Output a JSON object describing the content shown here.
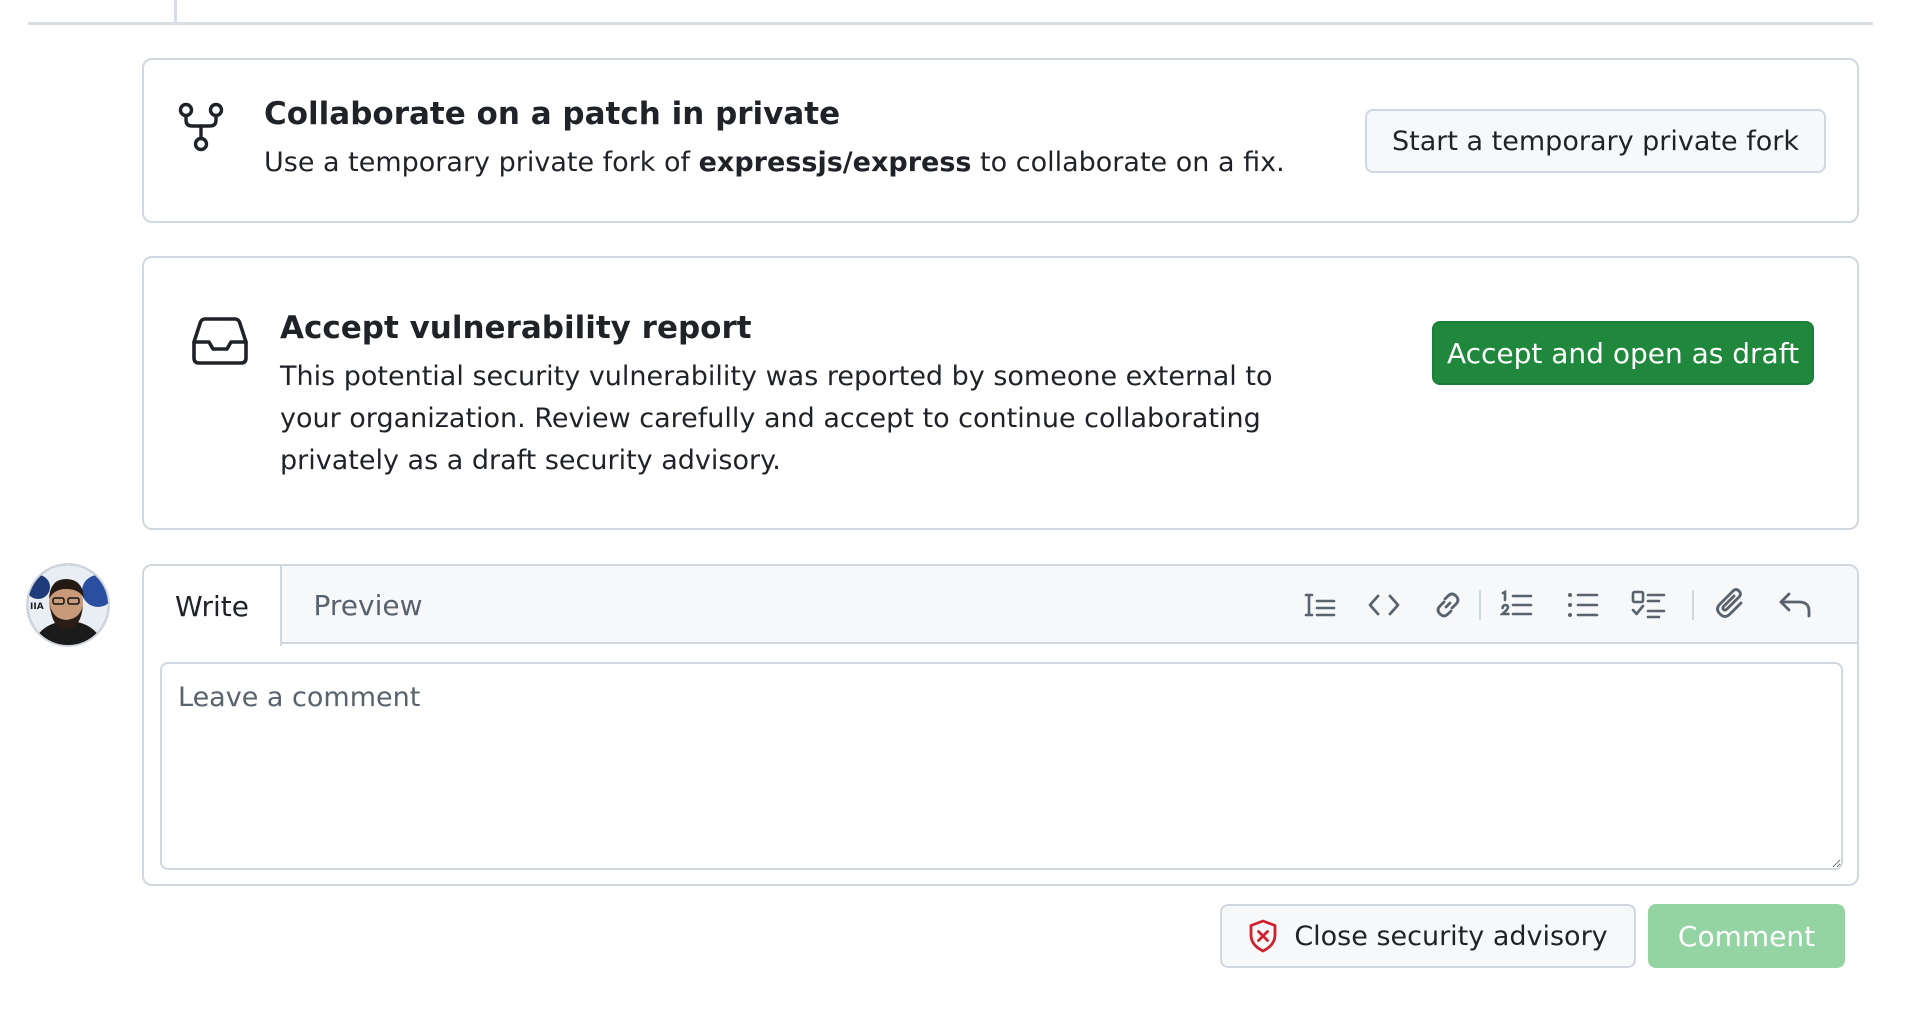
{
  "fork_card": {
    "title": "Collaborate on a patch in private",
    "desc_prefix": "Use a temporary private fork of ",
    "repo": "expressjs/express",
    "desc_suffix": " to collaborate on a fix.",
    "button_label": "Start a temporary private fork",
    "icon": "repo-forked-icon"
  },
  "accept_card": {
    "title": "Accept vulnerability report",
    "description": "This potential security vulnerability was reported by someone external to your organization. Review carefully and accept to continue collaborating privately as a draft security advisory.",
    "button_label": "Accept and open as draft",
    "icon": "inbox-icon"
  },
  "editor": {
    "tabs": [
      {
        "label": "Write",
        "active": true
      },
      {
        "label": "Preview",
        "active": false
      }
    ],
    "toolbar": [
      "heading-icon",
      "code-icon",
      "link-icon",
      "ordered-list-icon",
      "unordered-list-icon",
      "task-list-icon",
      "attach-icon",
      "reply-icon"
    ],
    "placeholder": "Leave a comment"
  },
  "actions": {
    "close_label": "Close security advisory",
    "comment_label": "Comment"
  },
  "colors": {
    "primary": "#1f883d",
    "primary_disabled": "#94d3a2",
    "border": "#d0d7de",
    "danger": "#cf222e"
  }
}
